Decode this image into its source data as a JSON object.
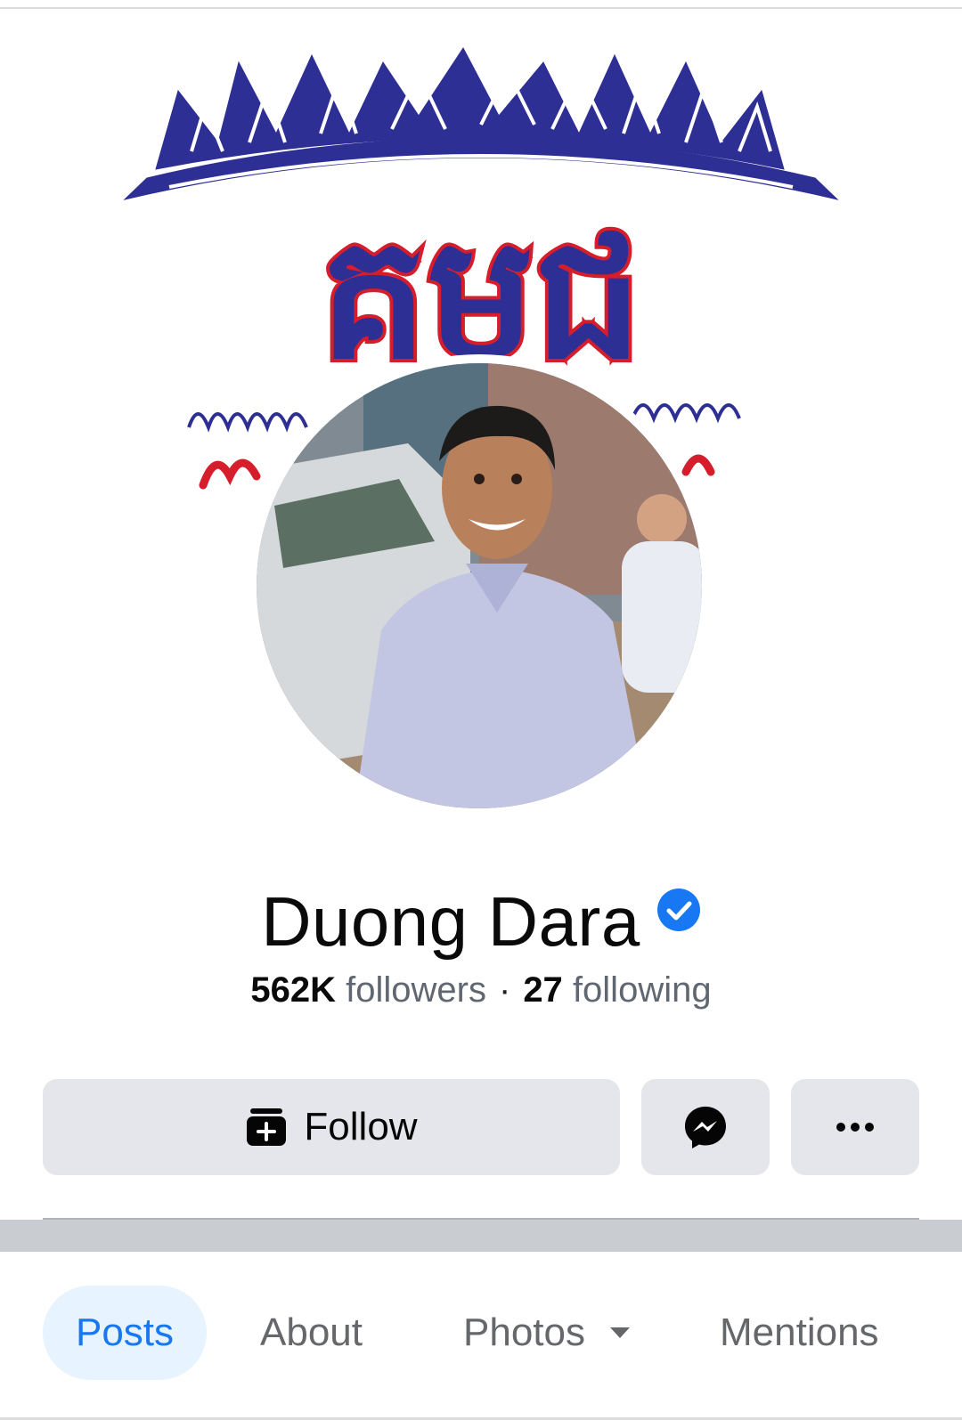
{
  "profile": {
    "name": "Duong Dara",
    "verified": true,
    "followers_count": "562K",
    "followers_label": "followers",
    "separator": "·",
    "following_count": "27",
    "following_label": "following"
  },
  "cover": {
    "logo_text": "គមជ"
  },
  "actions": {
    "follow_label": "Follow",
    "follow_icon": "add-friend-icon",
    "message_icon": "messenger-icon",
    "more_icon": "more-icon"
  },
  "tabs": [
    {
      "label": "Posts",
      "active": true
    },
    {
      "label": "About",
      "active": false
    },
    {
      "label": "Photos",
      "active": false,
      "has_dropdown": true
    },
    {
      "label": "Mentions",
      "active": false
    }
  ],
  "colors": {
    "accent": "#1877f2",
    "verified": "#1877f2",
    "cover_blue": "#2e2f94",
    "cover_red": "#d51d2b"
  }
}
